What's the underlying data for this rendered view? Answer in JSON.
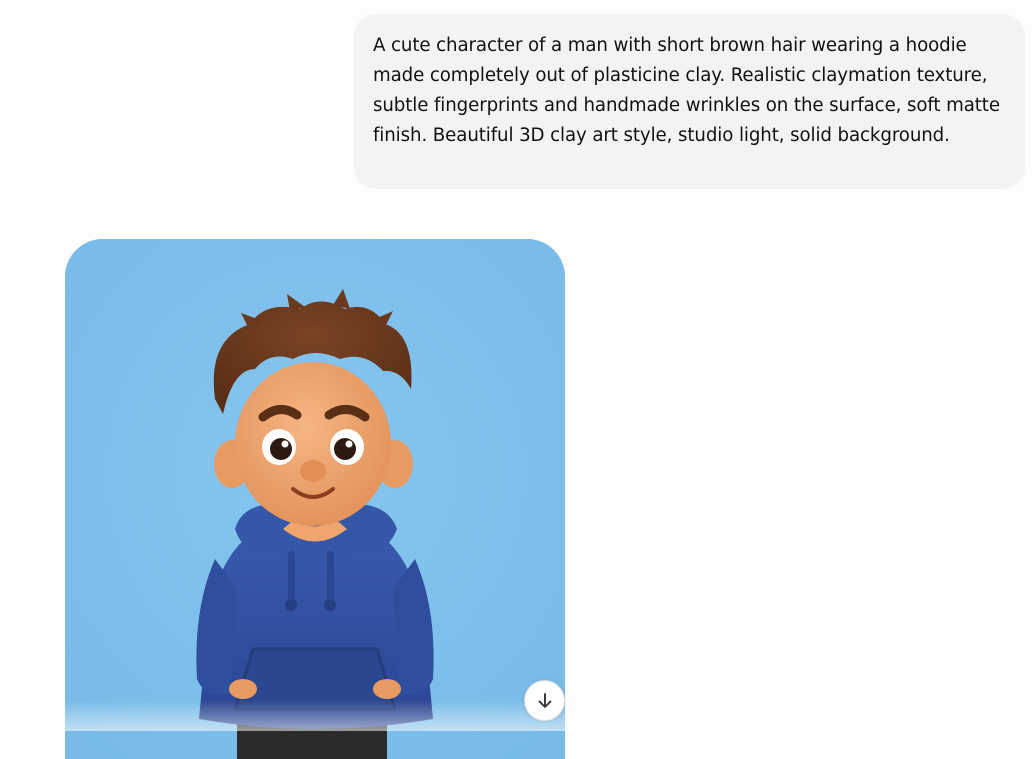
{
  "conversation": {
    "user_message": "A cute character of a man with short brown hair wearing a hoodie made completely out of plasticine clay. Realistic claymation texture, subtle fingerprints and handmade wrinkles on the surface, soft matte finish. Beautiful 3D clay art style, studio light, solid background.",
    "generated_image": {
      "background_color": "#7fc1ec",
      "hoodie_color": "#2f4f9e",
      "hair_color": "#6b3a1e",
      "skin_color": "#f0a56f"
    }
  },
  "scroll_button": {
    "icon": "arrow-down-icon"
  }
}
